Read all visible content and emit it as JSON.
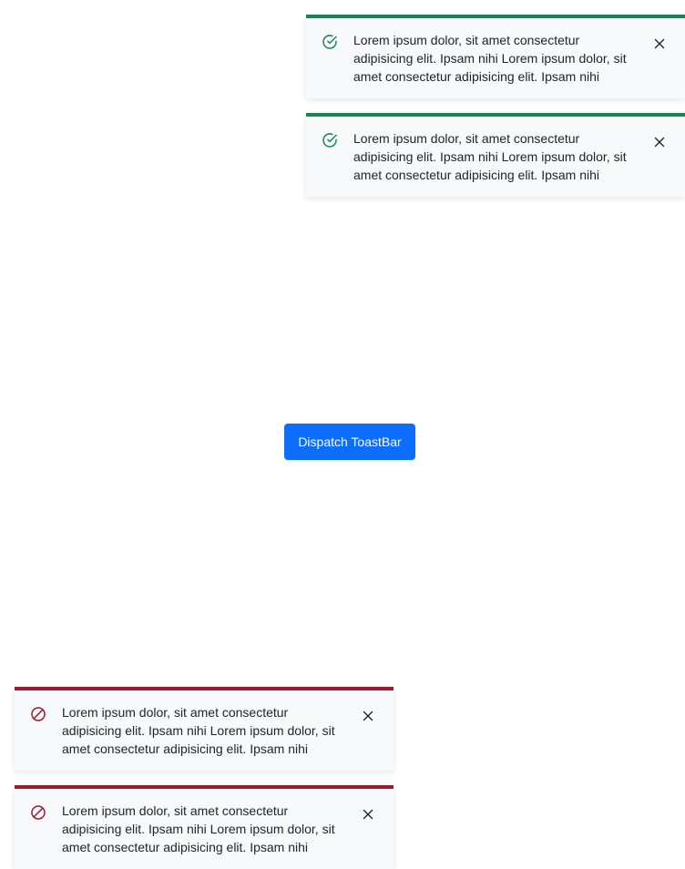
{
  "colors": {
    "success_accent": "#198754",
    "danger_accent": "#9b1b2c",
    "button_bg": "#0d6efd",
    "toast_bg": "#f8f9fa"
  },
  "button": {
    "label": "Dispatch ToastBar"
  },
  "toasts_top_right": [
    {
      "type": "success",
      "icon": "check-circle-icon",
      "message": "Lorem ipsum dolor, sit amet consectetur adipisicing elit. Ipsam nihi Lorem ipsum dolor, sit amet consectetur adipisicing elit. Ipsam nihi"
    },
    {
      "type": "success",
      "icon": "check-circle-icon",
      "message": "Lorem ipsum dolor, sit amet consectetur adipisicing elit. Ipsam nihi Lorem ipsum dolor, sit amet consectetur adipisicing elit. Ipsam nihi"
    }
  ],
  "toasts_bottom_left": [
    {
      "type": "danger",
      "icon": "ban-icon",
      "message": "Lorem ipsum dolor, sit amet consectetur adipisicing elit. Ipsam nihi Lorem ipsum dolor, sit amet consectetur adipisicing elit. Ipsam nihi"
    },
    {
      "type": "danger",
      "icon": "ban-icon",
      "message": "Lorem ipsum dolor, sit amet consectetur adipisicing elit. Ipsam nihi Lorem ipsum dolor, sit amet consectetur adipisicing elit. Ipsam nihi"
    }
  ]
}
